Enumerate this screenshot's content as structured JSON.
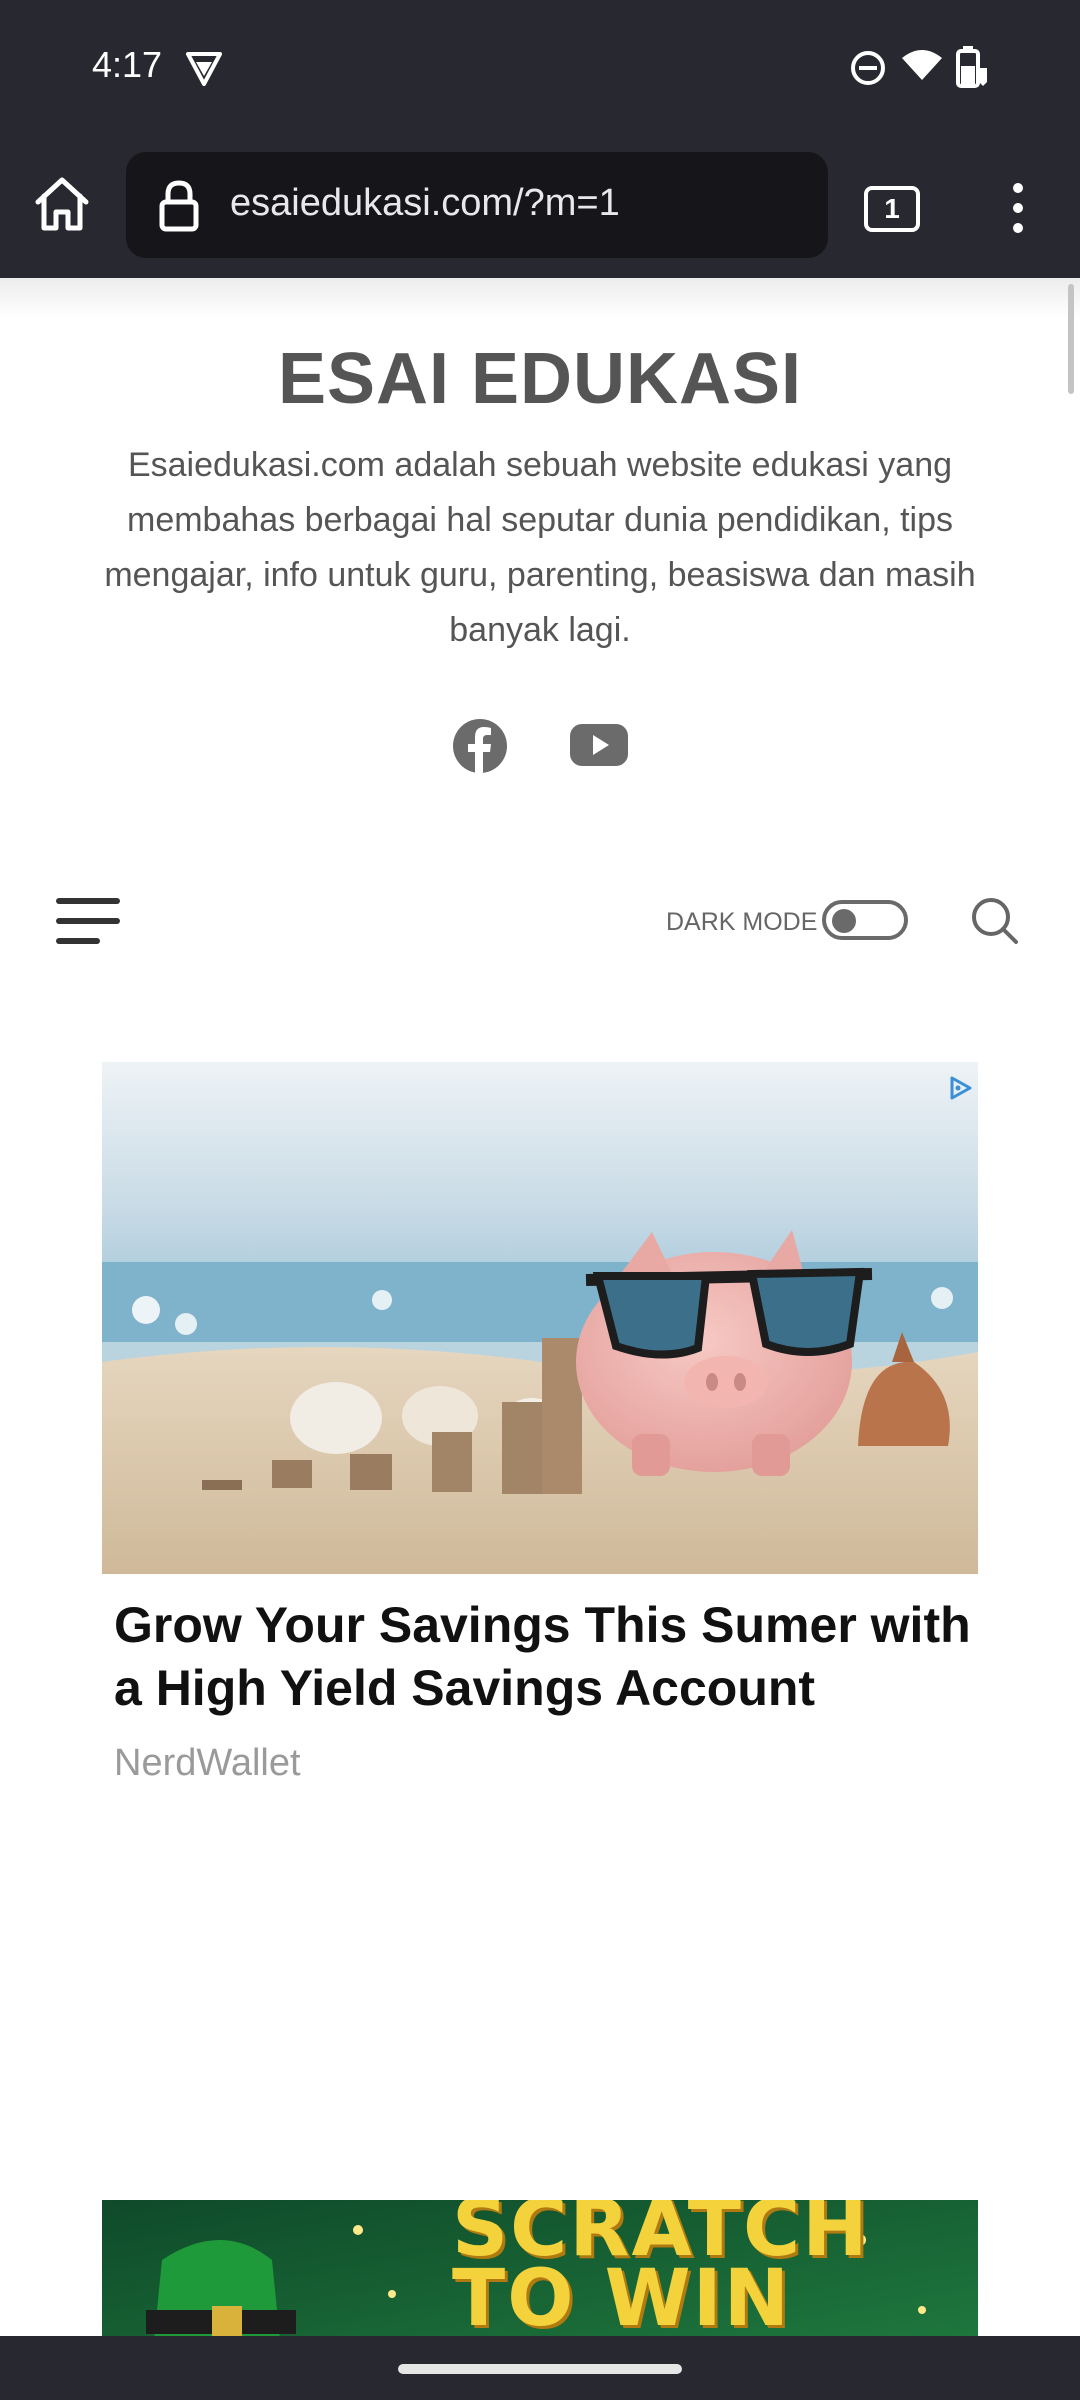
{
  "status_bar": {
    "time": "4:17",
    "icons": [
      "vpn-shield-icon",
      "do-not-disturb-icon",
      "wifi-icon",
      "battery-icon"
    ]
  },
  "browser": {
    "url": "esaiedukasi.com/?m=1",
    "tab_count": "1",
    "icons": [
      "home-icon",
      "lock-icon",
      "tabs-icon",
      "overflow-menu-icon"
    ]
  },
  "site": {
    "title": "ESAI EDUKASI",
    "description": "Esaiedukasi.com adalah sebuah website edukasi yang membahas berbagai hal seputar dunia pendidikan, tips mengajar, info untuk guru, parenting, beasiswa dan masih banyak lagi.",
    "social_icons": [
      "facebook-icon",
      "youtube-icon"
    ]
  },
  "nav": {
    "dark_mode_label": "DARK MODE",
    "dark_mode_on": false,
    "icons": [
      "hamburger-menu-icon",
      "search-icon"
    ]
  },
  "ad": {
    "headline": "Grow Your Savings This Sumer with a High Yield Savings Account",
    "source": "NerdWallet"
  },
  "ad2": {
    "line1": "SCRATCH",
    "line2": "TO WIN"
  },
  "colors": {
    "chrome_bg": "#282830",
    "url_field_bg": "#15151a",
    "text_gray": "#555555",
    "ad_headline": "#111111",
    "ad_source": "#9a9a9a"
  }
}
